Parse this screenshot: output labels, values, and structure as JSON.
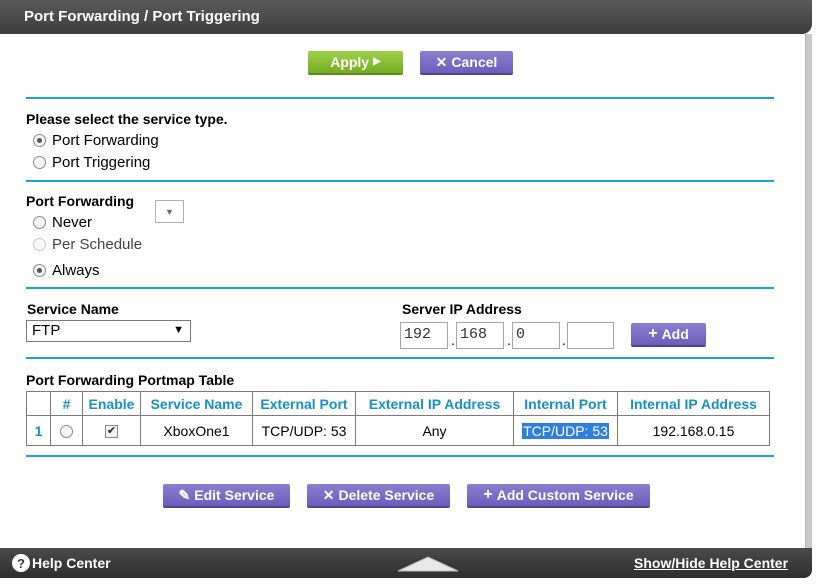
{
  "header": {
    "title": "Port Forwarding / Port Triggering"
  },
  "actions": {
    "apply_label": "Apply",
    "cancel_label": "Cancel"
  },
  "service_type": {
    "heading": "Please select the service type.",
    "options": [
      "Port Forwarding",
      "Port Triggering"
    ],
    "selected": "Port Forwarding"
  },
  "port_forwarding_schedule": {
    "heading": "Port Forwarding",
    "options": [
      "Never",
      "Per Schedule",
      "Always"
    ],
    "selected": "Always"
  },
  "service": {
    "label": "Service Name",
    "selected_value": "FTP"
  },
  "server_ip": {
    "label": "Server IP Address",
    "octets": [
      "192",
      "168",
      "0",
      ""
    ],
    "add_label": "Add"
  },
  "portmap": {
    "title": "Port Forwarding Portmap Table",
    "columns": [
      "",
      "#",
      "Enable",
      "Service Name",
      "External Port",
      "External IP Address",
      "Internal Port",
      "Internal IP Address"
    ],
    "rows": [
      {
        "index": "1",
        "enable": true,
        "service_name": "XboxOne1",
        "external_port": "TCP/UDP: 53",
        "external_ip": "Any",
        "internal_port": "TCP/UDP: 53",
        "internal_ip": "192.168.0.15"
      }
    ]
  },
  "bottom_actions": {
    "edit_label": "Edit Service",
    "delete_label": "Delete Service",
    "add_custom_label": "Add Custom Service"
  },
  "footer": {
    "help_label": "Help Center",
    "toggle_label": "Show/Hide Help Center"
  },
  "colors": {
    "accent_rule": "#1aa4cf",
    "header_text": "#1a8fc4",
    "button_purple": "#7367c4",
    "button_green": "#8dc23a",
    "text_selection": "#2f7fe0"
  }
}
